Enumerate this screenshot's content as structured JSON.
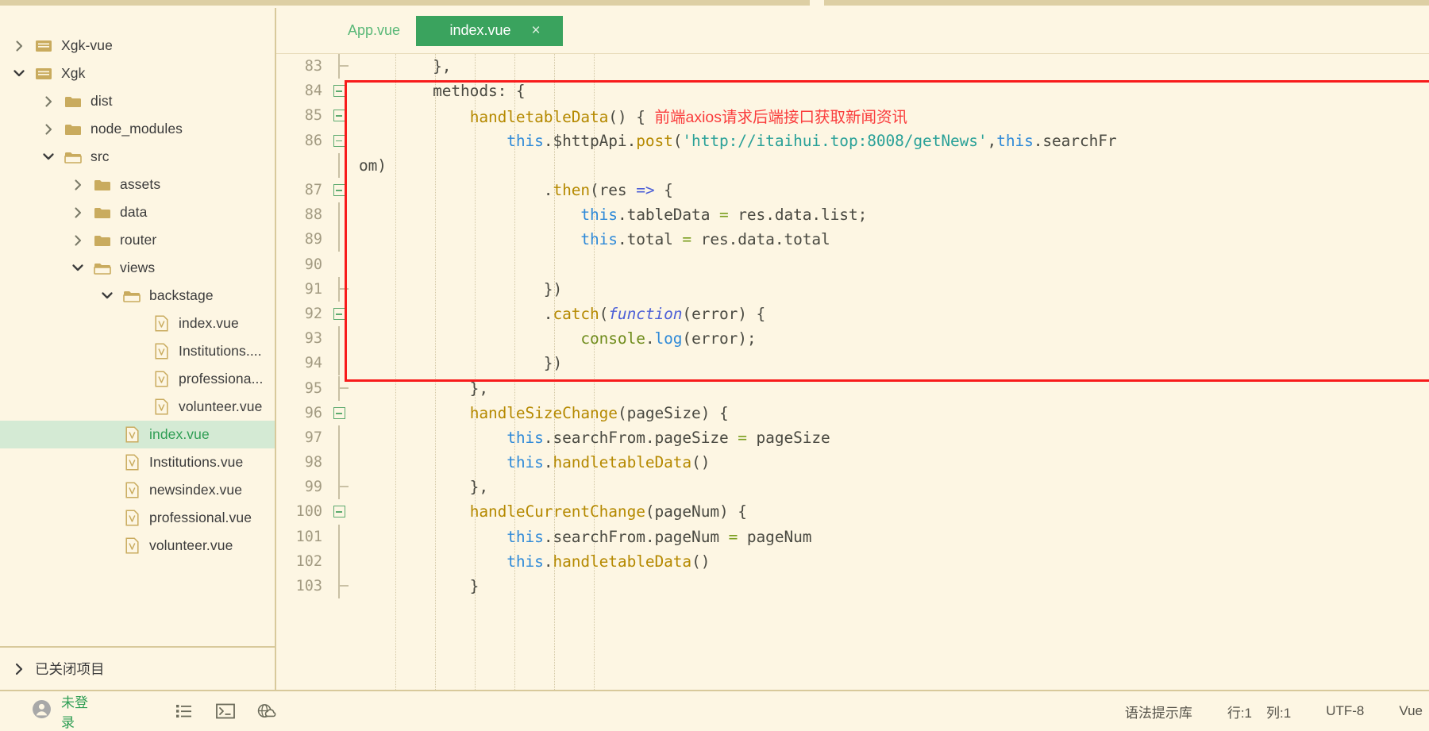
{
  "sidebar": {
    "tree": [
      {
        "label": "Xgk-vue",
        "indent": 0,
        "chevron": "right",
        "icon": "project-folder-icon",
        "selected": false
      },
      {
        "label": "Xgk",
        "indent": 0,
        "chevron": "down",
        "icon": "project-folder-icon",
        "selected": false
      },
      {
        "label": "dist",
        "indent": 1,
        "chevron": "right",
        "icon": "folder-closed-icon",
        "selected": false
      },
      {
        "label": "node_modules",
        "indent": 1,
        "chevron": "right",
        "icon": "folder-closed-icon",
        "selected": false
      },
      {
        "label": "src",
        "indent": 1,
        "chevron": "down",
        "icon": "folder-open-icon",
        "selected": false
      },
      {
        "label": "assets",
        "indent": 2,
        "chevron": "right",
        "icon": "folder-closed-icon",
        "selected": false
      },
      {
        "label": "data",
        "indent": 2,
        "chevron": "right",
        "icon": "folder-closed-icon",
        "selected": false
      },
      {
        "label": "router",
        "indent": 2,
        "chevron": "right",
        "icon": "folder-closed-icon",
        "selected": false
      },
      {
        "label": "views",
        "indent": 2,
        "chevron": "down",
        "icon": "folder-open-icon",
        "selected": false
      },
      {
        "label": "backstage",
        "indent": 3,
        "chevron": "down",
        "icon": "folder-open-icon",
        "selected": false
      },
      {
        "label": "index.vue",
        "indent": 4,
        "chevron": "none",
        "icon": "vue-file-icon",
        "selected": false
      },
      {
        "label": "Institutions....",
        "indent": 4,
        "chevron": "none",
        "icon": "vue-file-icon",
        "selected": false
      },
      {
        "label": "professiona...",
        "indent": 4,
        "chevron": "none",
        "icon": "vue-file-icon",
        "selected": false
      },
      {
        "label": "volunteer.vue",
        "indent": 4,
        "chevron": "none",
        "icon": "vue-file-icon",
        "selected": false
      },
      {
        "label": "index.vue",
        "indent": 3,
        "chevron": "none",
        "icon": "vue-file-icon",
        "selected": true
      },
      {
        "label": "Institutions.vue",
        "indent": 3,
        "chevron": "none",
        "icon": "vue-file-icon",
        "selected": false
      },
      {
        "label": "newsindex.vue",
        "indent": 3,
        "chevron": "none",
        "icon": "vue-file-icon",
        "selected": false
      },
      {
        "label": "professional.vue",
        "indent": 3,
        "chevron": "none",
        "icon": "vue-file-icon",
        "selected": false
      },
      {
        "label": "volunteer.vue",
        "indent": 3,
        "chevron": "none",
        "icon": "vue-file-icon",
        "selected": false
      }
    ],
    "closed_projects_label": "已关闭项目"
  },
  "tabs": [
    {
      "label": "App.vue",
      "active": false,
      "closable": false
    },
    {
      "label": "index.vue",
      "active": true,
      "closable": true,
      "close_glyph": "×"
    }
  ],
  "editor": {
    "annotation": "前端axios请求后端接口获取新闻资讯",
    "lines": [
      {
        "num": "83",
        "fold": "branch",
        "text": "        },"
      },
      {
        "num": "84",
        "fold": "box",
        "text": "        methods: {"
      },
      {
        "num": "85",
        "fold": "box",
        "text": "            handletableData() { "
      },
      {
        "num": "86",
        "fold": "box",
        "text": "                this.$httpApi.post('http://itaihui.top:8008/getNews',this.searchFr"
      },
      {
        "num": "",
        "fold": "line",
        "text": "om)"
      },
      {
        "num": "87",
        "fold": "box",
        "text": "                    .then(res => {"
      },
      {
        "num": "88",
        "fold": "line",
        "text": "                        this.tableData = res.data.list;"
      },
      {
        "num": "89",
        "fold": "line",
        "text": "                        this.total = res.data.total"
      },
      {
        "num": "90",
        "fold": "none",
        "text": ""
      },
      {
        "num": "91",
        "fold": "branch",
        "text": "                    })"
      },
      {
        "num": "92",
        "fold": "box",
        "text": "                    .catch(function(error) {"
      },
      {
        "num": "93",
        "fold": "line",
        "text": "                        console.log(error);"
      },
      {
        "num": "94",
        "fold": "line",
        "text": "                    })"
      },
      {
        "num": "95",
        "fold": "branch",
        "text": "            },"
      },
      {
        "num": "96",
        "fold": "box",
        "text": "            handleSizeChange(pageSize) {"
      },
      {
        "num": "97",
        "fold": "line",
        "text": "                this.searchFrom.pageSize = pageSize"
      },
      {
        "num": "98",
        "fold": "line",
        "text": "                this.handletableData()"
      },
      {
        "num": "99",
        "fold": "branch",
        "text": "            },"
      },
      {
        "num": "100",
        "fold": "box",
        "text": "            handleCurrentChange(pageNum) {"
      },
      {
        "num": "101",
        "fold": "line",
        "text": "                this.searchFrom.pageNum = pageNum"
      },
      {
        "num": "102",
        "fold": "line",
        "text": "                this.handletableData()"
      },
      {
        "num": "103",
        "fold": "branch",
        "text": "            }"
      }
    ]
  },
  "statusbar": {
    "user_label": "未登录",
    "icons": [
      "list-icon",
      "terminal-icon",
      "browser-cloud-icon"
    ],
    "syntax_lib": "语法提示库",
    "line_label": "行:1",
    "col_label": "列:1",
    "encoding": "UTF-8",
    "language": "Vue"
  },
  "colors": {
    "background": "#fdf6e3",
    "accent_green": "#3aa35e",
    "selection_green": "#d4ead4",
    "annotation_red": "#fa3c3c",
    "highlight_box_red": "#f81b1b",
    "folder_gold": "#c9ab5e",
    "gutter_text": "#a39b82"
  }
}
